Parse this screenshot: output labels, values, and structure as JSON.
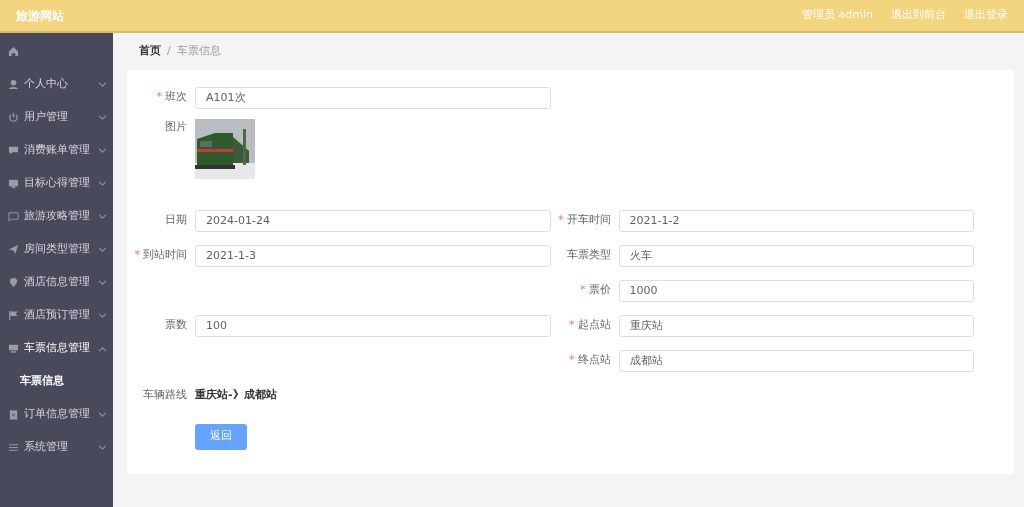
{
  "header": {
    "title": "旅游网站",
    "links": [
      "管理员 admin",
      "退出到前台",
      "退出登录"
    ]
  },
  "sidebar": {
    "items": [
      {
        "kind": "icon"
      },
      {
        "kind": "menu",
        "label": "个人中心",
        "expanded": false
      },
      {
        "kind": "menu",
        "label": "用户管理",
        "expanded": false
      },
      {
        "kind": "menu",
        "label": "消费账单管理",
        "expanded": false
      },
      {
        "kind": "menu",
        "label": "目标心得管理",
        "expanded": false
      },
      {
        "kind": "menu",
        "label": "旅游攻略管理",
        "expanded": false
      },
      {
        "kind": "menu",
        "label": "房间类型管理",
        "expanded": false
      },
      {
        "kind": "menu",
        "label": "酒店信息管理",
        "expanded": false
      },
      {
        "kind": "menu",
        "label": "酒店预订管理",
        "expanded": false
      },
      {
        "kind": "menu",
        "label": "车票信息管理",
        "expanded": true,
        "children": [
          {
            "label": "车票信息",
            "selected": true
          }
        ]
      },
      {
        "kind": "menu",
        "label": "订单信息管理",
        "expanded": false
      },
      {
        "kind": "menu",
        "label": "系统管理",
        "expanded": false
      }
    ]
  },
  "breadcrumb": {
    "items": [
      "首页",
      "车票信息"
    ],
    "separator": "/"
  },
  "form": {
    "rows": [
      {
        "kind": "fields",
        "left": {
          "label": "班次",
          "value": "A101次",
          "required_mark": "*"
        }
      },
      {
        "kind": "picture",
        "label": "图片"
      },
      {
        "kind": "fields",
        "left": {
          "label": "日期",
          "value": "2024-01-24"
        },
        "right": {
          "label": "开车时间",
          "value": "2021-1-2",
          "required_mark": "*"
        }
      },
      {
        "kind": "fields",
        "left": {
          "label": "到站时间",
          "value": "2021-1-3",
          "required_mark": "*"
        },
        "right": {
          "label": "车票类型",
          "value": "火车"
        }
      },
      {
        "kind": "fields",
        "right": {
          "label": "票价",
          "value": "1000",
          "required_mark": "*"
        }
      },
      {
        "kind": "fields",
        "left": {
          "label": "票数",
          "value": "100"
        },
        "right": {
          "label": "起点站",
          "value": "重庆站",
          "required_mark": "*"
        }
      },
      {
        "kind": "fields",
        "right": {
          "label": "终点站",
          "value": "成都站",
          "required_mark": "*"
        }
      },
      {
        "kind": "text",
        "label": "车辆路线",
        "value": "重庆站-》成都站"
      }
    ],
    "button": "返回"
  }
}
